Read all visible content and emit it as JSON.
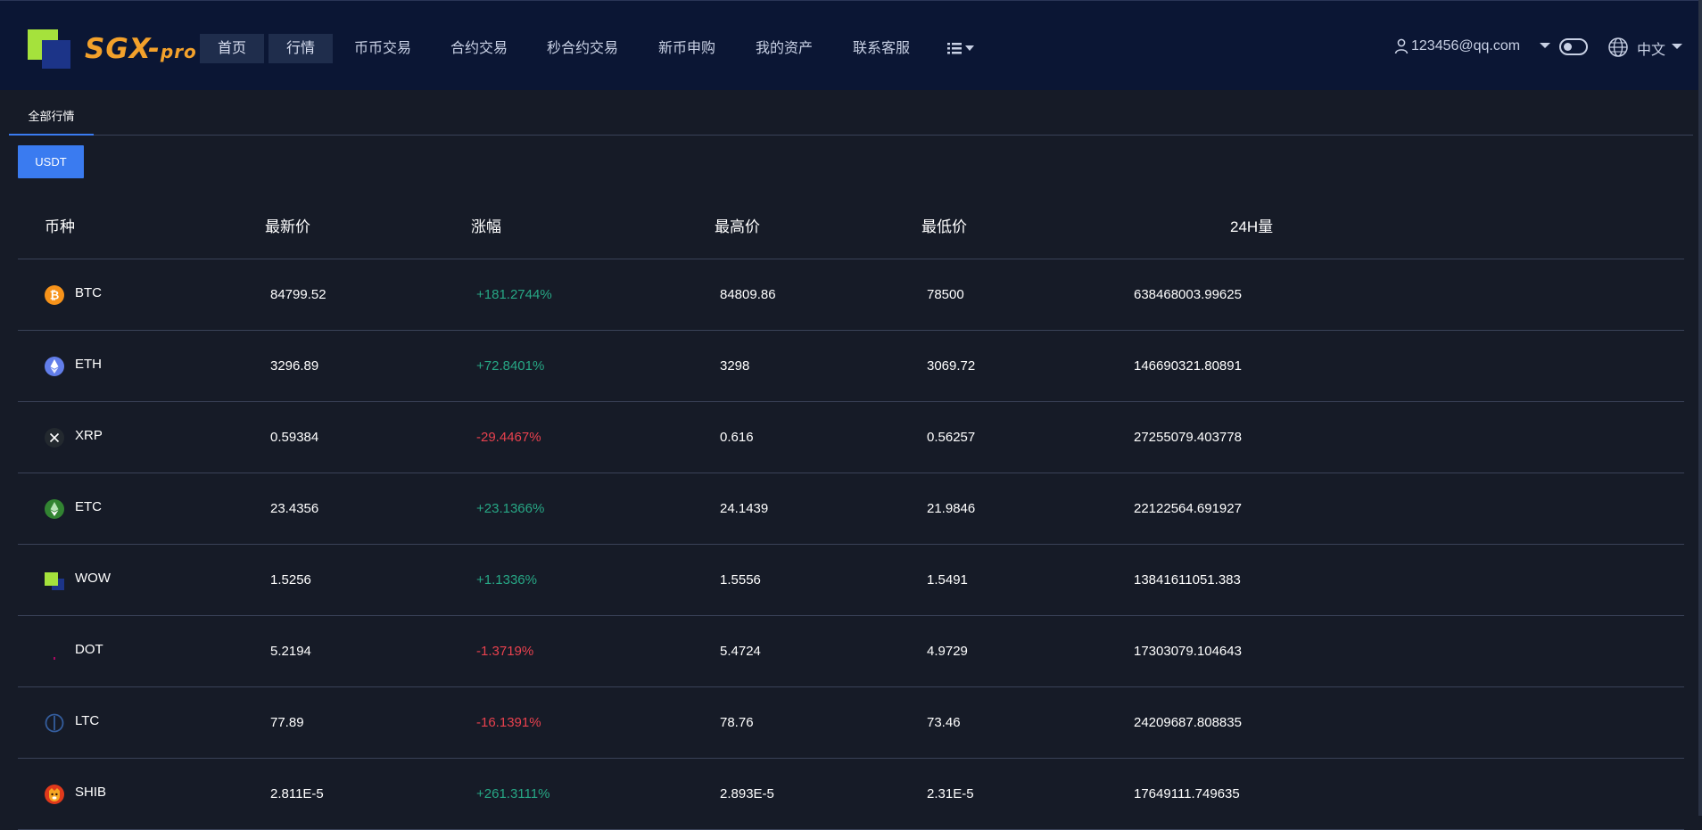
{
  "header": {
    "logo_text": "SGX-",
    "logo_suffix": "pro",
    "nav": [
      {
        "label": "首页",
        "active": true
      },
      {
        "label": "行情",
        "active": true
      },
      {
        "label": "币币交易",
        "active": false
      },
      {
        "label": "合约交易",
        "active": false
      },
      {
        "label": "秒合约交易",
        "active": false
      },
      {
        "label": "新币申购",
        "active": false
      },
      {
        "label": "我的资产",
        "active": false
      },
      {
        "label": "联系客服",
        "active": false
      }
    ],
    "user_email": "123456@qq.com",
    "language": "中文"
  },
  "tabs": [
    {
      "label": "全部行情"
    }
  ],
  "quote_button": "USDT",
  "table": {
    "headers": {
      "coin": "币种",
      "last": "最新价",
      "change": "涨幅",
      "high": "最高价",
      "low": "最低价",
      "volume": "24H量"
    },
    "rows": [
      {
        "coin": "BTC",
        "icon": "btc-icon",
        "last": "84799.52",
        "change": "+181.2744%",
        "dir": "up",
        "high": "84809.86",
        "low": "78500",
        "volume": "638468003.99625"
      },
      {
        "coin": "ETH",
        "icon": "eth-icon",
        "last": "3296.89",
        "change": "+72.8401%",
        "dir": "up",
        "high": "3298",
        "low": "3069.72",
        "volume": "146690321.80891"
      },
      {
        "coin": "XRP",
        "icon": "xrp-icon",
        "last": "0.59384",
        "change": "-29.4467%",
        "dir": "down",
        "high": "0.616",
        "low": "0.56257",
        "volume": "27255079.403778"
      },
      {
        "coin": "ETC",
        "icon": "etc-icon",
        "last": "23.4356",
        "change": "+23.1366%",
        "dir": "up",
        "high": "24.1439",
        "low": "21.9846",
        "volume": "22122564.691927"
      },
      {
        "coin": "WOW",
        "icon": "wow-icon",
        "last": "1.5256",
        "change": "+1.1336%",
        "dir": "up",
        "high": "1.5556",
        "low": "1.5491",
        "volume": "13841611051.383"
      },
      {
        "coin": "DOT",
        "icon": "dot-icon",
        "last": "5.2194",
        "change": "-1.3719%",
        "dir": "down",
        "high": "5.4724",
        "low": "4.9729",
        "volume": "17303079.104643"
      },
      {
        "coin": "LTC",
        "icon": "ltc-icon",
        "last": "77.89",
        "change": "-16.1391%",
        "dir": "down",
        "high": "78.76",
        "low": "73.46",
        "volume": "24209687.808835"
      },
      {
        "coin": "SHIB",
        "icon": "shib-icon",
        "last": "2.811E-5",
        "change": "+261.3111%",
        "dir": "up",
        "high": "2.893E-5",
        "low": "2.31E-5",
        "volume": "17649111.749635"
      }
    ]
  },
  "colors": {
    "background": "#161b27",
    "header": "#0b1634",
    "accent": "#3a7bf0",
    "up": "#27a785",
    "down": "#e8414e",
    "logo_text": "#f3a12b",
    "logo_green": "#a5e23c"
  }
}
